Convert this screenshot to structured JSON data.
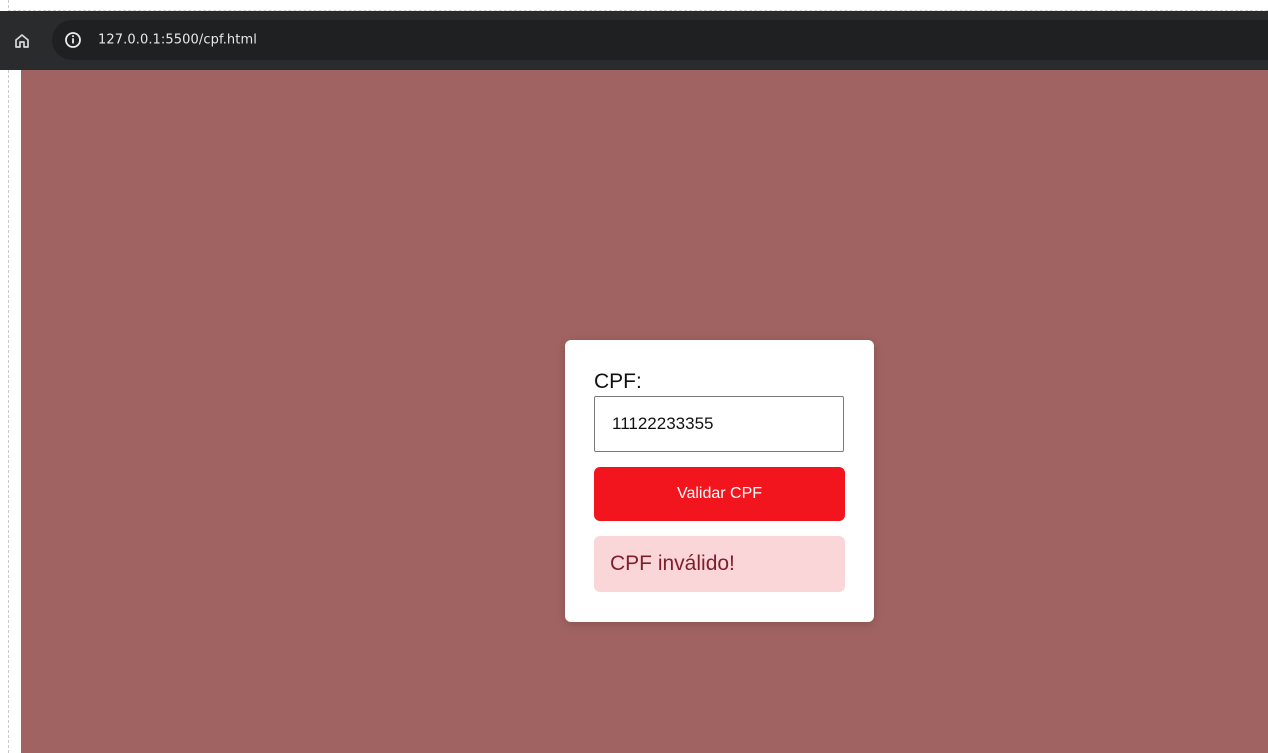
{
  "browser": {
    "url": "127.0.0.1:5500/cpf.html",
    "home_icon": "home-icon",
    "info_icon": "info-icon"
  },
  "page": {
    "background_color": "#a16361"
  },
  "form": {
    "label": "CPF:",
    "input_value": "11122233355",
    "button_label": "Validar CPF",
    "button_color": "#f2151d",
    "result_text": "CPF inválido!",
    "result_background": "#fad6d9",
    "result_text_color": "#7e1f2a"
  }
}
